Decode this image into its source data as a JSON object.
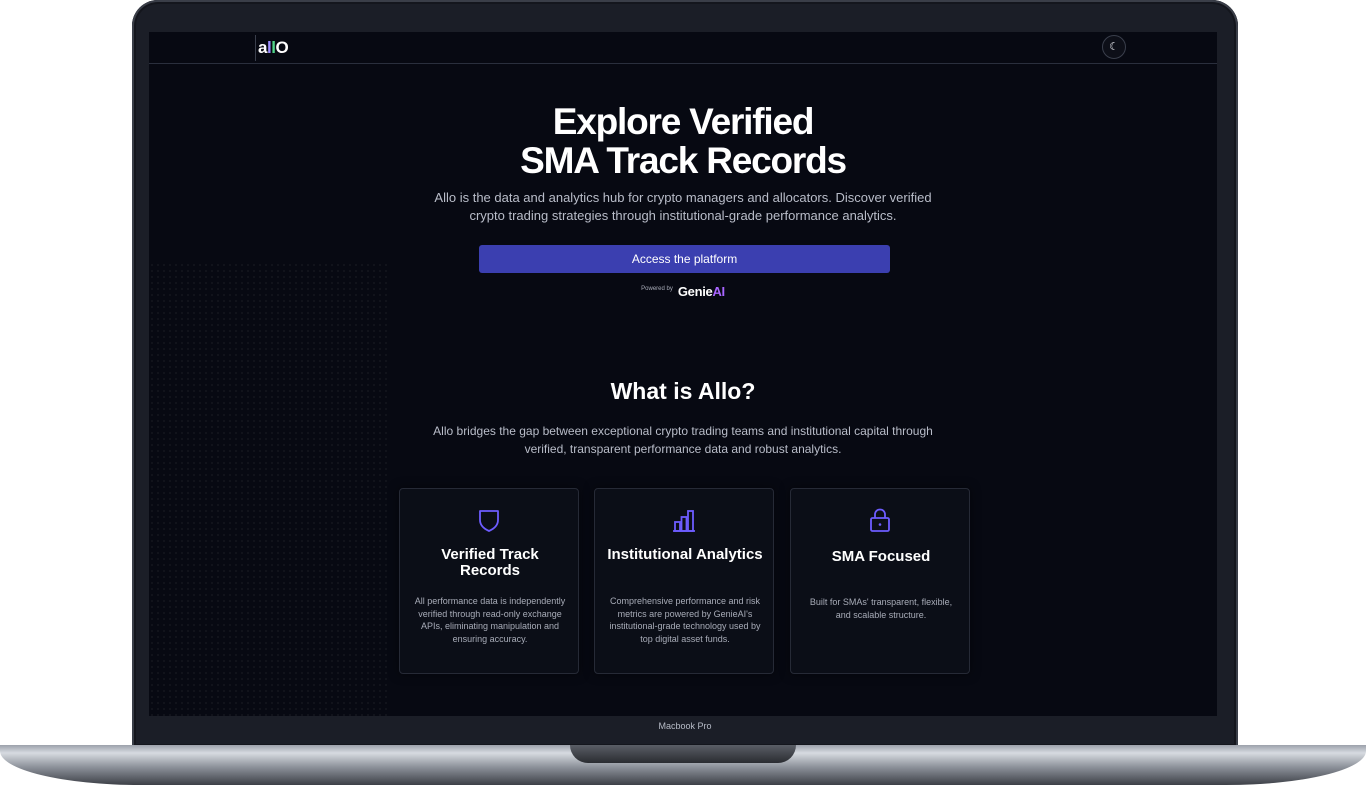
{
  "device": {
    "label": "Macbook Pro"
  },
  "nav": {
    "logo": {
      "part1": "a",
      "part2": "l",
      "part3": "l",
      "part4": "O"
    },
    "theme_toggle_icon": "moon-icon",
    "theme_toggle_glyph": "☾"
  },
  "hero": {
    "title_line1": "Explore Verified",
    "title_line2": "SMA Track Records",
    "subtitle": "Allo is the data and analytics hub for crypto managers and allocators. Discover verified crypto trading strategies through institutional-grade performance analytics.",
    "cta_label": "Access the platform",
    "powered_by_label": "Powered by",
    "powered_by_brand_main": "Genie",
    "powered_by_brand_accent": "AI"
  },
  "about": {
    "title": "What is Allo?",
    "subtitle": "Allo bridges the gap between exceptional crypto trading teams and institutional capital through verified, transparent performance data and robust analytics."
  },
  "cards": [
    {
      "icon": "shield-icon",
      "title": "Verified Track Records",
      "text": "All performance data is independently verified through read-only exchange APIs, eliminating manipulation and ensuring accuracy."
    },
    {
      "icon": "bar-chart-icon",
      "title": "Institutional Analytics",
      "text": "Comprehensive performance and risk metrics are powered by GenieAI's institutional-grade technology used by top digital asset funds."
    },
    {
      "icon": "lock-icon",
      "title": "SMA Focused",
      "text": "Built for SMAs' transparent, flexible, and scalable structure."
    }
  ],
  "colors": {
    "background": "#070912",
    "accent": "#3b3fb0",
    "icon_accent": "#6d5cff",
    "genie_accent": "#a865ff"
  }
}
